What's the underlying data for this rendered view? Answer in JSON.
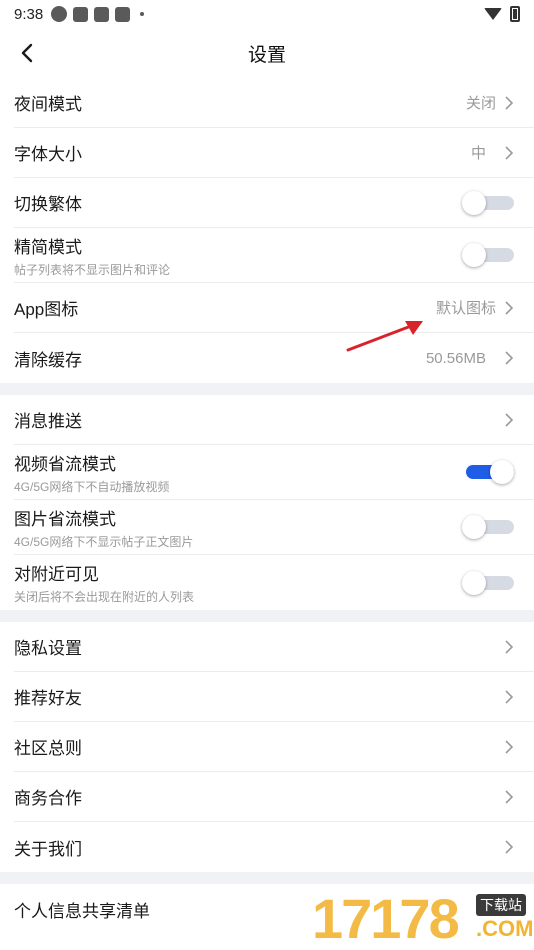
{
  "status_bar": {
    "time": "9:38"
  },
  "nav": {
    "title": "设置"
  },
  "groups": [
    {
      "rows": [
        {
          "label": "夜间模式",
          "value": "关闭",
          "type": "chevron"
        },
        {
          "label": "字体大小",
          "value": "中",
          "type": "chevron"
        },
        {
          "label": "切换繁体",
          "type": "toggle",
          "on": false
        },
        {
          "label": "精简模式",
          "sub": "帖子列表将不显示图片和评论",
          "type": "toggle",
          "on": false
        },
        {
          "label": "App图标",
          "value": "默认图标",
          "type": "chevron"
        },
        {
          "label": "清除缓存",
          "value": "50.56MB",
          "type": "chevron"
        }
      ]
    },
    {
      "rows": [
        {
          "label": "消息推送",
          "type": "chevron"
        },
        {
          "label": "视频省流模式",
          "sub": "4G/5G网络下不自动播放视频",
          "type": "toggle",
          "on": true
        },
        {
          "label": "图片省流模式",
          "sub": "4G/5G网络下不显示帖子正文图片",
          "type": "toggle",
          "on": false
        },
        {
          "label": "对附近可见",
          "sub": "关闭后将不会出现在附近的人列表",
          "type": "toggle",
          "on": false
        }
      ]
    },
    {
      "rows": [
        {
          "label": "隐私设置",
          "type": "chevron"
        },
        {
          "label": "推荐好友",
          "type": "chevron"
        },
        {
          "label": "社区总则",
          "type": "chevron"
        },
        {
          "label": "商务合作",
          "type": "chevron"
        },
        {
          "label": "关于我们",
          "type": "chevron"
        }
      ]
    },
    {
      "rows": [
        {
          "label": "个人信息共享清单",
          "type": "chevron"
        }
      ]
    }
  ],
  "watermark": {
    "digits": "17178",
    "badge": "下载站",
    "suffix": ".COM"
  },
  "colors": {
    "accent": "#1f5de6",
    "annotation_arrow": "#d8232a",
    "watermark": "#f2b431"
  }
}
